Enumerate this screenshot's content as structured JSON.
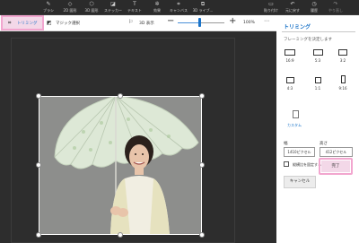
{
  "ribbon": {
    "items": [
      {
        "icon": "brush-icon",
        "glyph": "✎",
        "label": "ブラシ"
      },
      {
        "icon": "shapes-2d-icon",
        "glyph": "◇",
        "label": "2D 図形"
      },
      {
        "icon": "shapes-3d-icon",
        "glyph": "⬡",
        "label": "3D 図形"
      },
      {
        "icon": "sticker-icon",
        "glyph": "◪",
        "label": "ステッカー"
      },
      {
        "icon": "text-icon",
        "glyph": "T",
        "label": "テキスト"
      },
      {
        "icon": "effects-icon",
        "glyph": "✲",
        "label": "効果"
      },
      {
        "icon": "canvas-icon",
        "glyph": "⌗",
        "label": "キャンバス"
      },
      {
        "icon": "library-3d-icon",
        "glyph": "⧉",
        "label": "3D ライブ..."
      },
      {
        "icon": "paste-icon",
        "glyph": "▭",
        "label": "貼り付け"
      },
      {
        "icon": "undo-icon",
        "glyph": "↶",
        "label": "元に戻す"
      },
      {
        "icon": "history-icon",
        "glyph": "◷",
        "label": "履歴"
      },
      {
        "icon": "redo-icon",
        "glyph": "↷",
        "label": "やり直し"
      }
    ]
  },
  "toolbar": {
    "crop_label": "トリミング",
    "magic_select_label": "マジック選択",
    "view3d_label": "3D 表示",
    "zoom_minus": "−",
    "zoom_plus": "+",
    "zoom_percent": "100%",
    "more": "⋯",
    "zoom_level": 0.45
  },
  "panel": {
    "title": "トリミング",
    "subtitle": "フレーミングを決定します",
    "ratios": [
      {
        "label": "16:9"
      },
      {
        "label": "5:3"
      },
      {
        "label": "3:2"
      },
      {
        "label": "4:3"
      },
      {
        "label": "1:1"
      },
      {
        "label": "9:16"
      }
    ],
    "custom_label": "カスタム",
    "width_label": "幅",
    "height_label": "高さ",
    "width_value": "1410ピクセル",
    "height_value": "412ピクセル",
    "lock_label": "縦横比を固定する",
    "cancel_label": "キャンセル",
    "done_label": "完了"
  },
  "colors": {
    "accent": "#1a73c8",
    "highlight_pink": "#f2a6cf",
    "ribbon_bg": "#2b2b2b",
    "canvas_bg": "#2d2d2d"
  }
}
